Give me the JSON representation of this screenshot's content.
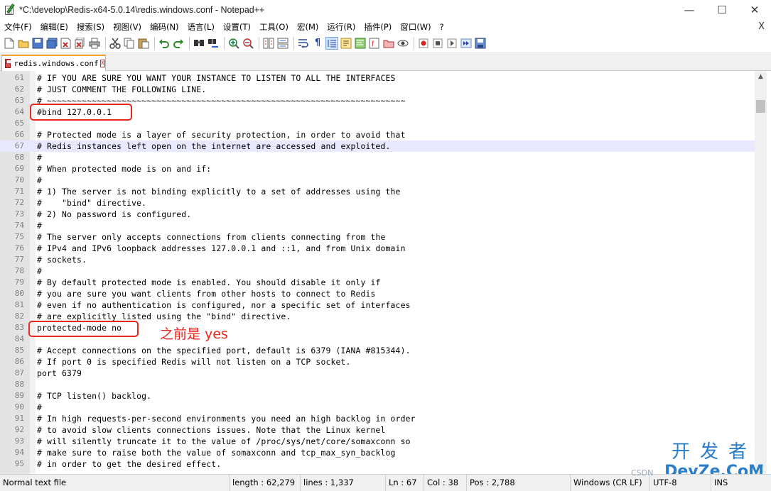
{
  "window": {
    "title": "*C:\\develop\\Redis-x64-5.0.14\\redis.windows.conf - Notepad++",
    "minimize": "—",
    "maximize": "☐",
    "close": "✕"
  },
  "menu": {
    "items": [
      "文件(F)",
      "编辑(E)",
      "搜索(S)",
      "视图(V)",
      "编码(N)",
      "语言(L)",
      "设置(T)",
      "工具(O)",
      "宏(M)",
      "运行(R)",
      "插件(P)",
      "窗口(W)",
      "?"
    ],
    "close_doc": "X"
  },
  "toolbar": {
    "icons": [
      "new-file-icon",
      "open-file-icon",
      "save-icon",
      "save-all-icon",
      "close-icon",
      "close-all-icon",
      "print-icon",
      "cut-icon",
      "copy-icon",
      "paste-icon",
      "undo-icon",
      "redo-icon",
      "find-icon",
      "replace-icon",
      "zoom-in-icon",
      "zoom-out-icon",
      "sync-vertical-icon",
      "sync-horizontal-icon",
      "word-wrap-icon",
      "show-all-chars-icon",
      "indent-guide-icon",
      "user-lang-icon",
      "doc-map-icon",
      "function-list-icon",
      "folder-workspace-icon",
      "monitor-icon",
      "record-macro-icon",
      "stop-macro-icon",
      "play-macro-icon",
      "run-macro-multiple-icon",
      "save-macro-icon"
    ]
  },
  "tab": {
    "label": "redis.windows.conf",
    "close": "x"
  },
  "editor": {
    "current_line": 67,
    "lines": [
      {
        "n": "61",
        "t": "# IF YOU ARE SURE YOU WANT YOUR INSTANCE TO LISTEN TO ALL THE INTERFACES"
      },
      {
        "n": "62",
        "t": "# JUST COMMENT THE FOLLOWING LINE."
      },
      {
        "n": "63",
        "t": "# ~~~~~~~~~~~~~~~~~~~~~~~~~~~~~~~~~~~~~~~~~~~~~~~~~~~~~~~~~~~~~~~~~~~~~~~~"
      },
      {
        "n": "64",
        "t": "#bind 127.0.0.1"
      },
      {
        "n": "65",
        "t": ""
      },
      {
        "n": "66",
        "t": "# Protected mode is a layer of security protection, in order to avoid that"
      },
      {
        "n": "67",
        "t": "# Redis instances left open on the internet are accessed and exploited."
      },
      {
        "n": "68",
        "t": "#"
      },
      {
        "n": "69",
        "t": "# When protected mode is on and if:"
      },
      {
        "n": "70",
        "t": "#"
      },
      {
        "n": "71",
        "t": "# 1) The server is not binding explicitly to a set of addresses using the"
      },
      {
        "n": "72",
        "t": "#    \"bind\" directive."
      },
      {
        "n": "73",
        "t": "# 2) No password is configured."
      },
      {
        "n": "74",
        "t": "#"
      },
      {
        "n": "75",
        "t": "# The server only accepts connections from clients connecting from the"
      },
      {
        "n": "76",
        "t": "# IPv4 and IPv6 loopback addresses 127.0.0.1 and ::1, and from Unix domain"
      },
      {
        "n": "77",
        "t": "# sockets."
      },
      {
        "n": "78",
        "t": "#"
      },
      {
        "n": "79",
        "t": "# By default protected mode is enabled. You should disable it only if"
      },
      {
        "n": "80",
        "t": "# you are sure you want clients from other hosts to connect to Redis"
      },
      {
        "n": "81",
        "t": "# even if no authentication is configured, nor a specific set of interfaces"
      },
      {
        "n": "82",
        "t": "# are explicitly listed using the \"bind\" directive."
      },
      {
        "n": "83",
        "t": "protected-mode no"
      },
      {
        "n": "84",
        "t": ""
      },
      {
        "n": "85",
        "t": "# Accept connections on the specified port, default is 6379 (IANA #815344)."
      },
      {
        "n": "86",
        "t": "# If port 0 is specified Redis will not listen on a TCP socket."
      },
      {
        "n": "87",
        "t": "port 6379"
      },
      {
        "n": "88",
        "t": ""
      },
      {
        "n": "89",
        "t": "# TCP listen() backlog."
      },
      {
        "n": "90",
        "t": "#"
      },
      {
        "n": "91",
        "t": "# In high requests-per-second environments you need an high backlog in order"
      },
      {
        "n": "92",
        "t": "# to avoid slow clients connections issues. Note that the Linux kernel"
      },
      {
        "n": "93",
        "t": "# will silently truncate it to the value of /proc/sys/net/core/somaxconn so"
      },
      {
        "n": "94",
        "t": "# make sure to raise both the value of somaxconn and tcp_max_syn_backlog"
      },
      {
        "n": "95",
        "t": "# in order to get the desired effect."
      }
    ]
  },
  "annotation": {
    "note": "之前是 yes",
    "color": "#e8281e"
  },
  "statusbar": {
    "type": "Normal text file",
    "length": "length : 62,279",
    "lines": "lines : 1,337",
    "ln": "Ln : 67",
    "col": "Col : 38",
    "pos": "Pos : 2,788",
    "eol": "Windows (CR LF)",
    "encoding": "UTF-8",
    "mode": "INS"
  },
  "watermark": {
    "top": "开发者",
    "bottom": "DevZe.CoM",
    "csdn": "CSDN"
  }
}
